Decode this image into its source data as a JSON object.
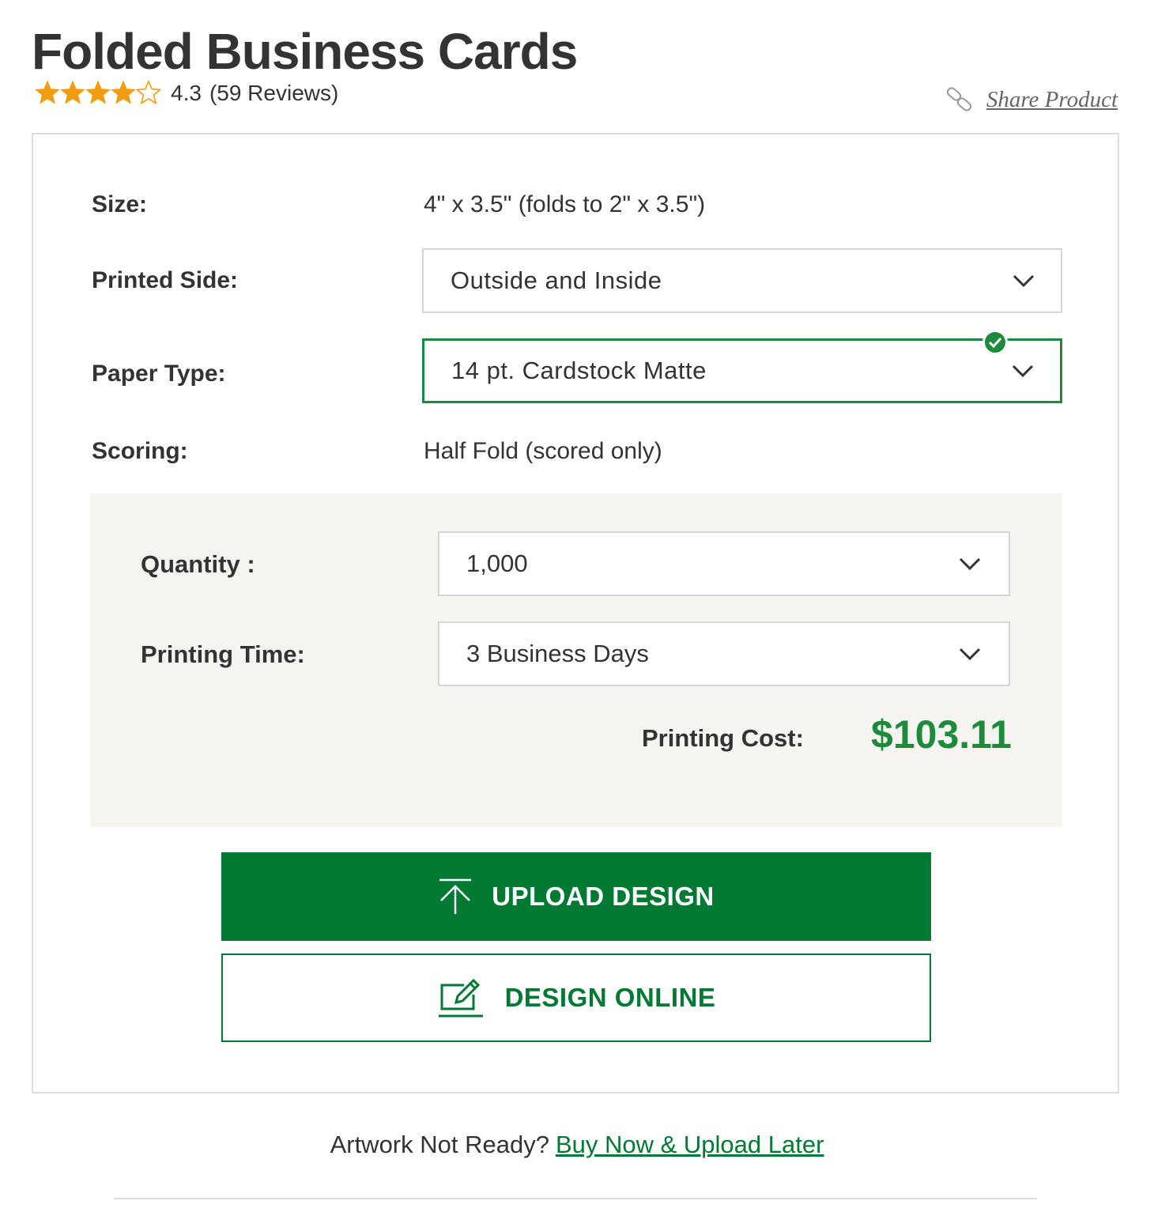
{
  "product": {
    "title": "Folded Business Cards",
    "rating_value": "4.3",
    "rating_score": 4.3,
    "rating_max": 5,
    "reviews": "(59 Reviews)",
    "star_color": "#f39c12"
  },
  "share": {
    "label": "Share Product",
    "icon": "link-icon"
  },
  "options": {
    "size_label": "Size:",
    "size_value": "4\" x 3.5\" (folds to 2\" x 3.5\")",
    "printed_side_label": "Printed Side:",
    "printed_side_value": "Outside and Inside",
    "paper_type_label": "Paper Type:",
    "paper_type_value": "14 pt. Cardstock Matte",
    "scoring_label": "Scoring:",
    "scoring_value": "Half Fold (scored only)"
  },
  "pricing": {
    "quantity_label": "Quantity :",
    "quantity_value": "1,000",
    "printing_time_label": "Printing Time:",
    "printing_time_value": "3 Business Days",
    "cost_label": "Printing Cost:",
    "cost_value": "$103.11"
  },
  "actions": {
    "upload_label": "UPLOAD DESIGN",
    "upload_icon": "upload-icon",
    "design_label": "DESIGN ONLINE",
    "design_icon": "edit-icon"
  },
  "artwork": {
    "prefix": "Artwork Not Ready?",
    "link": "Buy Now & Upload Later"
  },
  "colors": {
    "brand_green": "#007a33",
    "price_green": "#1e8a3c",
    "panel_bg": "#f5f4f1",
    "text": "#333333"
  }
}
